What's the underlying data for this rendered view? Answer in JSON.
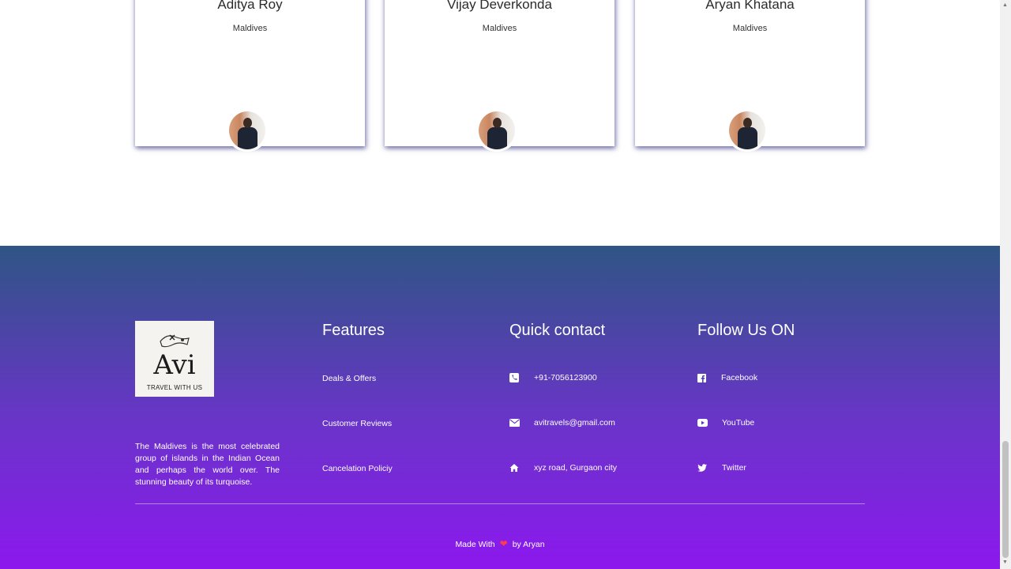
{
  "testimonials": [
    {
      "name": "Aditya Roy",
      "location": "Maldives"
    },
    {
      "name": "Vijay Deverkonda",
      "location": "Maldives"
    },
    {
      "name": "Aryan Khatana",
      "location": "Maldives"
    }
  ],
  "footer": {
    "logo": {
      "title": "Avi",
      "subtitle": "TRAVEL WITH US"
    },
    "about": "The Maldives is the most celebrated group of islands in the Indian Ocean and perhaps the world over. The stunning beauty of its turquoise.",
    "features": {
      "title": "Features",
      "links": [
        "Deals & Offers",
        "Customer Reviews",
        "Cancelation Policiy"
      ]
    },
    "contact": {
      "title": "Quick contact",
      "items": [
        {
          "icon": "phone-icon",
          "text": "+91-7056123900"
        },
        {
          "icon": "envelope-icon",
          "text": "avitravels@gmail.com"
        },
        {
          "icon": "home-icon",
          "text": "xyz road, Gurgaon city"
        }
      ]
    },
    "social": {
      "title": "Follow Us ON",
      "items": [
        {
          "icon": "facebook-icon",
          "text": "Facebook"
        },
        {
          "icon": "youtube-icon",
          "text": "YouTube"
        },
        {
          "icon": "twitter-icon",
          "text": "Twitter"
        }
      ]
    },
    "credit": {
      "prefix": "Made With",
      "suffix": "by Aryan",
      "heart_color": "#ff3b4e"
    }
  },
  "colors": {
    "footer_top": "#2f5585",
    "footer_bottom": "#8c18ee"
  }
}
